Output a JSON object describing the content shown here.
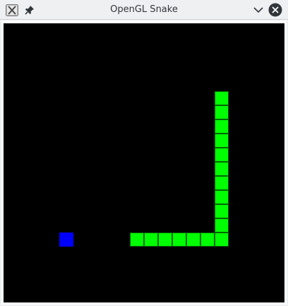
{
  "window": {
    "title": "OpenGL Snake"
  },
  "icons": {
    "app": "x-app-icon",
    "pin": "pin-icon",
    "minimize": "chevron-down-icon",
    "close": "close-icon"
  },
  "game": {
    "background_color": "#000000",
    "snake_color": "#00ff00",
    "food_color": "#0000ff",
    "snake": [
      {
        "col": 15,
        "row": 5
      },
      {
        "col": 15,
        "row": 6
      },
      {
        "col": 15,
        "row": 7
      },
      {
        "col": 15,
        "row": 8
      },
      {
        "col": 15,
        "row": 9
      },
      {
        "col": 15,
        "row": 10
      },
      {
        "col": 15,
        "row": 11
      },
      {
        "col": 15,
        "row": 12
      },
      {
        "col": 15,
        "row": 13
      },
      {
        "col": 15,
        "row": 14
      },
      {
        "col": 15,
        "row": 15
      },
      {
        "col": 14,
        "row": 15
      },
      {
        "col": 13,
        "row": 15
      },
      {
        "col": 12,
        "row": 15
      },
      {
        "col": 11,
        "row": 15
      },
      {
        "col": 10,
        "row": 15
      },
      {
        "col": 9,
        "row": 15
      }
    ],
    "food": {
      "col": 4,
      "row": 15
    }
  }
}
